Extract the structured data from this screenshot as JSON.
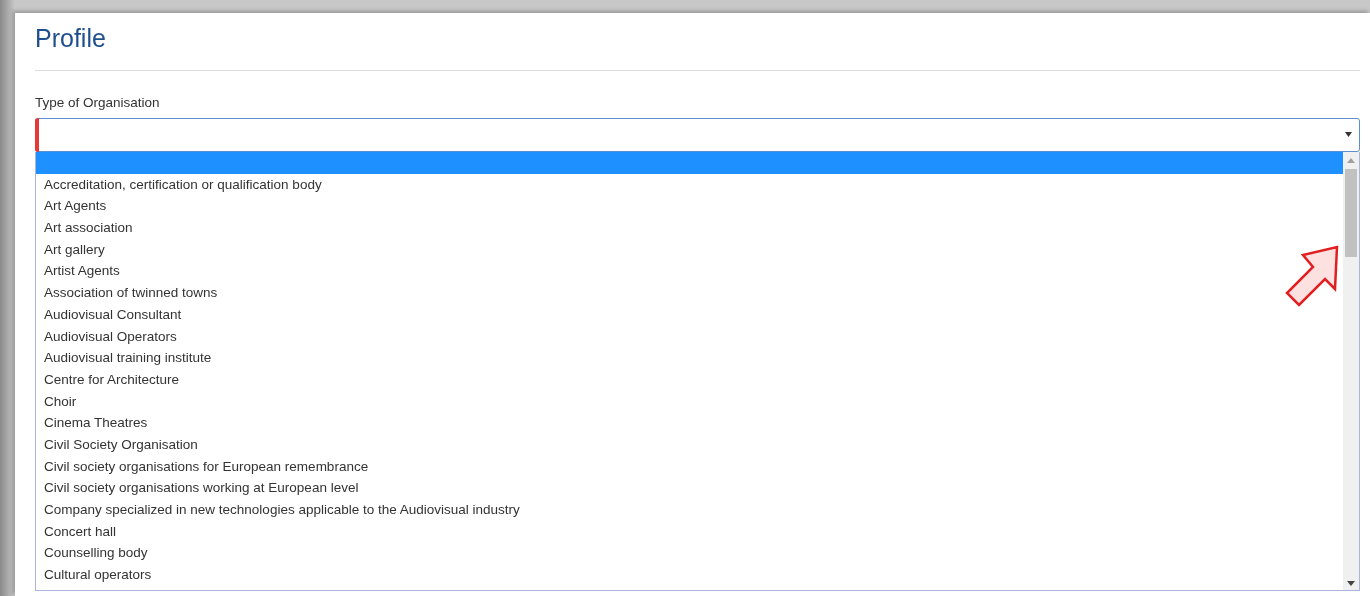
{
  "title": "Profile",
  "field": {
    "label": "Type of Organisation",
    "invalid": true,
    "expanded": true
  },
  "options": [
    {
      "selected": true
    },
    {
      "label": "Accreditation, certification or qualification body",
      "selected": false
    },
    {
      "label": "Art Agents",
      "selected": false
    },
    {
      "label": "Art association",
      "selected": false
    },
    {
      "label": "Art gallery",
      "selected": false
    },
    {
      "label": "Artist Agents",
      "selected": false
    },
    {
      "label": "Association of twinned towns",
      "selected": false
    },
    {
      "label": "Audiovisual Consultant",
      "selected": false
    },
    {
      "label": "Audiovisual Operators",
      "selected": false
    },
    {
      "label": "Audiovisual training institute",
      "selected": false
    },
    {
      "label": "Centre for Architecture",
      "selected": false
    },
    {
      "label": "Choir",
      "selected": false
    },
    {
      "label": "Cinema Theatres",
      "selected": false
    },
    {
      "label": "Civil Society Organisation",
      "selected": false
    },
    {
      "label": "Civil society organisations for European remembrance",
      "selected": false
    },
    {
      "label": "Civil society organisations working at European level",
      "selected": false
    },
    {
      "label": "Company specialized in new technologies applicable to the Audiovisual industry",
      "selected": false
    },
    {
      "label": "Concert hall",
      "selected": false
    },
    {
      "label": "Counselling body",
      "selected": false
    },
    {
      "label": "Cultural operators",
      "selected": false
    }
  ]
}
